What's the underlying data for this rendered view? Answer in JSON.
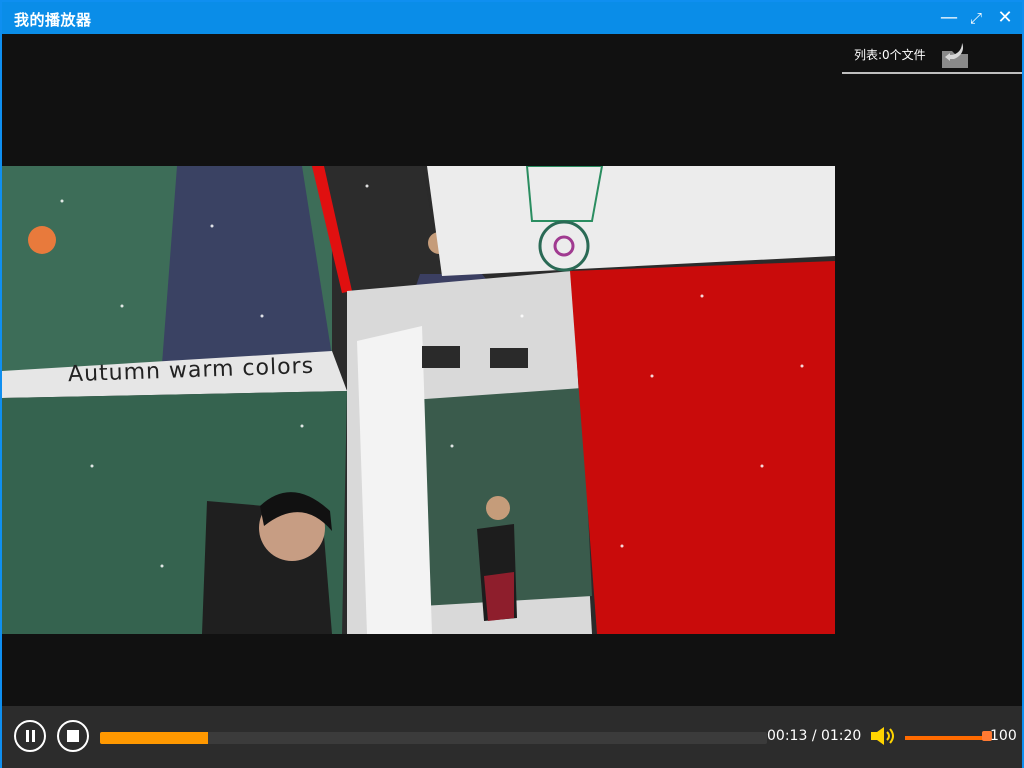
{
  "window": {
    "title": "我的播放器"
  },
  "playlist": {
    "label": "列表:0个文件"
  },
  "video": {
    "caption": "Autumn warm colors"
  },
  "controls": {
    "current_time": "00:13",
    "total_time": "01:20",
    "progress": 0.1625,
    "volume": 100,
    "volume_label": "100"
  },
  "colors": {
    "accent": "#0a8de8",
    "progress": "#ff9800",
    "volume": "#ff6a00"
  },
  "icons": {
    "minimize": "minimize-icon",
    "maximize": "maximize-icon",
    "close": "close-icon",
    "folder": "folder-icon",
    "pause": "pause-icon",
    "stop": "stop-icon",
    "volume": "speaker-icon"
  }
}
